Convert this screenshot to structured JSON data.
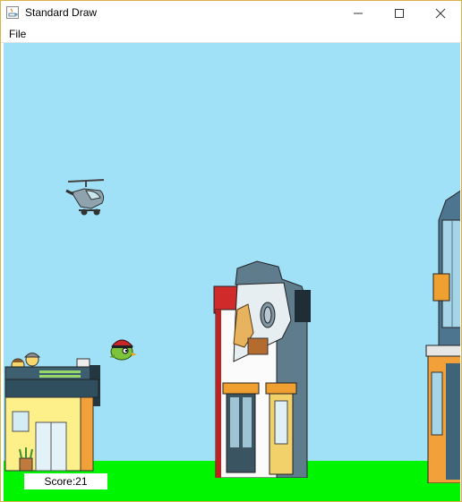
{
  "window": {
    "title": "Standard Draw"
  },
  "menu": {
    "items": [
      "File"
    ]
  },
  "game": {
    "score_text": "Score:21",
    "colors": {
      "sky": "#a1e1f8",
      "ground": "#00f500"
    }
  }
}
